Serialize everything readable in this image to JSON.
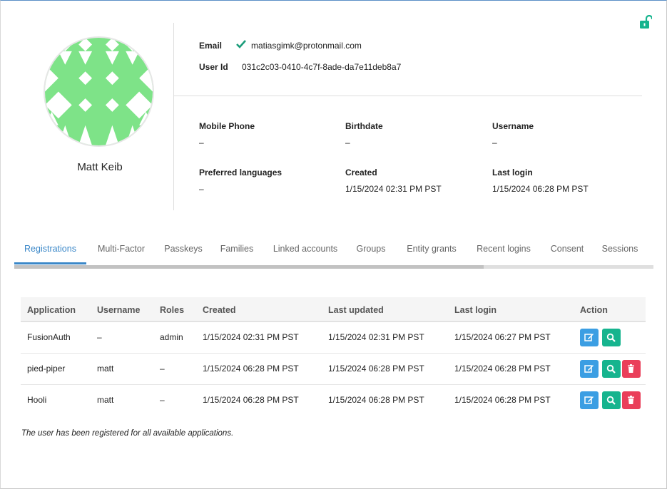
{
  "user": {
    "name": "Matt Keib",
    "email_label": "Email",
    "email": "matiasgimk@protonmail.com",
    "userid_label": "User Id",
    "userid": "031c2c03-0410-4c7f-8ade-da7e11deb8a7"
  },
  "details": [
    {
      "label": "Mobile Phone",
      "value": "–"
    },
    {
      "label": "Birthdate",
      "value": "–"
    },
    {
      "label": "Username",
      "value": "–"
    },
    {
      "label": "Preferred languages",
      "value": "–"
    },
    {
      "label": "Created",
      "value": "1/15/2024 02:31 PM PST"
    },
    {
      "label": "Last login",
      "value": "1/15/2024 06:28 PM PST"
    }
  ],
  "tabs": [
    {
      "label": "Registrations",
      "active": true
    },
    {
      "label": "Multi-Factor"
    },
    {
      "label": "Passkeys"
    },
    {
      "label": "Families"
    },
    {
      "label": "Linked accounts"
    },
    {
      "label": "Groups"
    },
    {
      "label": "Entity grants"
    },
    {
      "label": "Recent logins"
    },
    {
      "label": "Consent"
    },
    {
      "label": "Sessions"
    }
  ],
  "table": {
    "headers": [
      "Application",
      "Username",
      "Roles",
      "Created",
      "Last updated",
      "Last login",
      "Action"
    ],
    "rows": [
      {
        "application": "FusionAuth",
        "username": "–",
        "roles": "admin",
        "created": "1/15/2024 02:31 PM PST",
        "last_updated": "1/15/2024 02:31 PM PST",
        "last_login": "1/15/2024 06:27 PM PST",
        "actions": [
          "edit",
          "view"
        ]
      },
      {
        "application": "pied-piper",
        "username": "matt",
        "roles": "–",
        "created": "1/15/2024 06:28 PM PST",
        "last_updated": "1/15/2024 06:28 PM PST",
        "last_login": "1/15/2024 06:28 PM PST",
        "actions": [
          "edit",
          "view",
          "delete"
        ]
      },
      {
        "application": "Hooli",
        "username": "matt",
        "roles": "–",
        "created": "1/15/2024 06:28 PM PST",
        "last_updated": "1/15/2024 06:28 PM PST",
        "last_login": "1/15/2024 06:28 PM PST",
        "actions": [
          "edit",
          "view",
          "delete"
        ]
      }
    ]
  },
  "note": "The user has been registered for all available applications.",
  "icons": {
    "lock": "unlocked-padlock-icon",
    "email_verified": "checkmark-icon",
    "edit": "edit-icon",
    "view": "search-icon",
    "delete": "trash-icon"
  },
  "colors": {
    "accent": "#3a87c8",
    "avatar": "#7ee388",
    "edit_button": "#3b9ee3",
    "view_button": "#16b48e",
    "delete_button": "#ea3f5a",
    "verified": "#1a9c7a"
  }
}
